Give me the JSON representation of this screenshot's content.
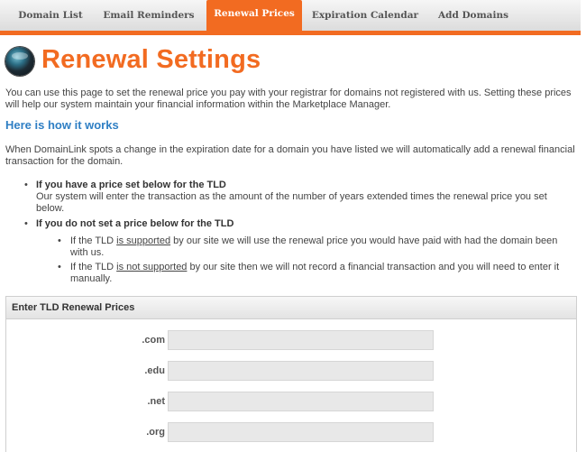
{
  "tabs": [
    {
      "label": "Domain List"
    },
    {
      "label": "Email Reminders"
    },
    {
      "label": "Renewal Prices"
    },
    {
      "label": "Expiration Calendar"
    },
    {
      "label": "Add Domains"
    }
  ],
  "active_tab": "Renewal Prices",
  "page_title": "Renewal Settings",
  "intro": "You can use this page to set the renewal price you pay with your registrar for domains not registered with us. Setting these prices will help our system maintain your financial information within the Marketplace Manager.",
  "how_it_works_heading": "Here is how it works",
  "how_it_works_text": "When DomainLink spots a change in the expiration date for a domain you have listed we will automatically add a renewal financial transaction for the domain.",
  "bullets": {
    "price_set": {
      "title": "If you have a price set below for the TLD",
      "text": "Our system will enter the transaction as the amount of the number of years extended times the renewal price you set below."
    },
    "price_not_set": {
      "title": "If you do not set a price below for the TLD",
      "supported": {
        "prefix": "If the TLD ",
        "link": "is supported",
        "suffix": " by our site we will use the renewal price you would have paid with had the domain been with us."
      },
      "not_supported": {
        "prefix": "If the TLD ",
        "link": "is not supported",
        "suffix": " by our site then we will not record a financial transaction and you will need to enter it manually."
      }
    }
  },
  "panel": {
    "header": "Enter TLD Renewal Prices",
    "tlds": [
      {
        "label": ".com",
        "value": ""
      },
      {
        "label": ".edu",
        "value": ""
      },
      {
        "label": ".net",
        "value": ""
      },
      {
        "label": ".org",
        "value": ""
      }
    ]
  },
  "colors": {
    "accent": "#f26b21",
    "link_heading": "#2f7fc4"
  }
}
